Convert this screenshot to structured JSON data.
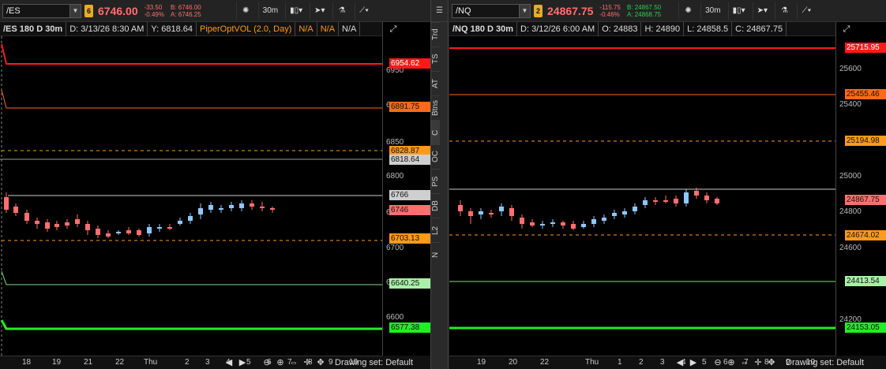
{
  "colors": {
    "down": "#ff6f6f",
    "up": "#8fc8ff",
    "red_line": "#ff1a1a",
    "orange_line": "#ff6a1a",
    "dashed_orange": "#ff9a1a",
    "green_light": "#7fe07f",
    "green": "#22ee22",
    "grey_line": "#cfcfcf"
  },
  "left": {
    "symbol": "/ES",
    "link": "6",
    "link_color": "#e6ac2a",
    "last": "6746.00",
    "chg": "-33.50",
    "chg_pct": "-0.49%",
    "bid": "B: 6746.00",
    "ask": "A: 6746.25",
    "interval": "30m",
    "header": {
      "title": "/ES 180 D 30m",
      "date": "D: 3/13/26 8:30 AM",
      "y": "Y: 6818.64",
      "study": "PiperOptVOL (2.0, Day)",
      "v1": "N/A",
      "v2": "N/A",
      "v3": "N/A"
    },
    "ticks": [
      "6950",
      "6900",
      "6850",
      "6800",
      "6750",
      "6700",
      "6650",
      "6600"
    ],
    "labels": [
      {
        "text": "6954.62",
        "bg": "#ff1a1a",
        "fg": "#fff"
      },
      {
        "text": "6891.75",
        "bg": "#ff6a1a",
        "fg": "#111"
      },
      {
        "text": "6828.87",
        "bg": "#ff9a1a",
        "fg": "#111"
      },
      {
        "text": "6818.64",
        "bg": "#cfcfcf",
        "fg": "#111"
      },
      {
        "text": "6766",
        "bg": "#cfcfcf",
        "fg": "#111"
      },
      {
        "text": "6746",
        "bg": "#ff6f6f",
        "fg": "#111"
      },
      {
        "text": "6703.13",
        "bg": "#ff9a1a",
        "fg": "#111"
      },
      {
        "text": "6640.25",
        "bg": "#a8f0a8",
        "fg": "#111"
      },
      {
        "text": "6577.38",
        "bg": "#22ee22",
        "fg": "#111"
      }
    ],
    "xticks": [
      "18",
      "19",
      "21",
      "22",
      "Thu",
      "2",
      "3",
      "4",
      "5",
      "6",
      "7",
      "8",
      "9",
      "10"
    ],
    "drawing_set": "Drawing set: Default"
  },
  "right": {
    "symbol": "/NQ",
    "link": "2",
    "link_color": "#e6ac2a",
    "last": "24867.75",
    "chg": "-115.75",
    "chg_pct": "-0.46%",
    "bid": "B: 24867.50",
    "ask": "A: 24868.75",
    "interval": "30m",
    "header": {
      "title": "/NQ 180 D 30m",
      "date": "D: 3/12/26 6:00 AM",
      "o": "O: 24883",
      "h": "H: 24890",
      "l": "L: 24858.5",
      "c": "C: 24867.75"
    },
    "ticks": [
      "25600",
      "25400",
      "25000",
      "24800",
      "24600",
      "24200"
    ],
    "labels": [
      {
        "text": "25715.95",
        "bg": "#ff1a1a",
        "fg": "#fff"
      },
      {
        "text": "25455.46",
        "bg": "#ff6a1a",
        "fg": "#111"
      },
      {
        "text": "25194.98",
        "bg": "#ff9a1a",
        "fg": "#111"
      },
      {
        "text": "24867.75",
        "bg": "#ff6f6f",
        "fg": "#111"
      },
      {
        "text": "24674.02",
        "bg": "#ff9a1a",
        "fg": "#111"
      },
      {
        "text": "24413.54",
        "bg": "#a8f0a8",
        "fg": "#111"
      },
      {
        "text": "24153.05",
        "bg": "#22ee22",
        "fg": "#111"
      }
    ],
    "xticks": [
      "19",
      "20",
      "22",
      "Thu",
      "1",
      "2",
      "3",
      "4",
      "5",
      "6",
      "7",
      "8",
      "9",
      "10"
    ],
    "drawing_set": "Drawing set: Default"
  },
  "sidebar": [
    "Trd",
    "TS",
    "AT",
    "Btns",
    "C",
    "OC",
    "PS",
    "DB",
    "L2",
    "N"
  ]
}
